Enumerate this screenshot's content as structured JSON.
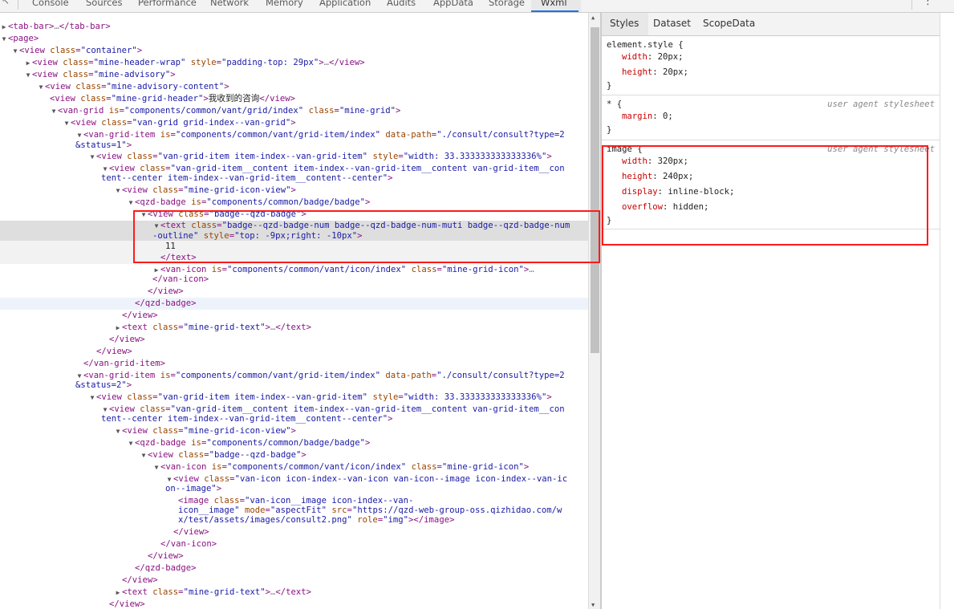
{
  "devtools_tabs": [
    "Console",
    "Sources",
    "Performance",
    "Network",
    "Memory",
    "Application",
    "Audits",
    "AppData",
    "Storage",
    "Wxml"
  ],
  "active_tab": "Wxml",
  "elements": {
    "l01": {
      "a": "<tab-bar>",
      "b": "…",
      "c": "</tab-bar>"
    },
    "l02": {
      "t": "<page>"
    },
    "l03": {
      "open": "<view",
      "an": "class",
      "av": "\"container\"",
      "close": ">"
    },
    "l04": {
      "open": "<view",
      "an": "class",
      "av": "\"mine-header-wrap\"",
      "an2": "style",
      "av2": "\"padding-top: 29px\"",
      "close": ">",
      "ell": "…",
      "end": "</view>"
    },
    "l05": {
      "open": "<view",
      "an": "class",
      "av": "\"mine-advisory\"",
      "close": ">"
    },
    "l06": {
      "open": "<view",
      "an": "class",
      "av": "\"mine-advisory-content\"",
      "close": ">"
    },
    "l07": {
      "open": "<view",
      "an": "class",
      "av": "\"mine-grid-header\"",
      "close": ">",
      "text": "我收到的咨询",
      "end": "</view>"
    },
    "l08": {
      "open": "<van-grid",
      "an": "is",
      "av": "\"components/common/vant/grid/index\"",
      "an2": "class",
      "av2": "\"mine-grid\"",
      "close": ">"
    },
    "l09": {
      "open": "<view",
      "an": "class",
      "av": "\"van-grid grid-index--van-grid\"",
      "close": ">"
    },
    "l10": {
      "open": "<van-grid-item",
      "an": "is",
      "av": "\"components/common/vant/grid-item/index\"",
      "an2": "data-path",
      "av2": "\"./consult/consult?type=2"
    },
    "l10b": {
      "av": "&status=1\"",
      "close": ">"
    },
    "l11": {
      "open": "<view",
      "an": "class",
      "av": "\"van-grid-item item-index--van-grid-item\"",
      "an2": "style",
      "av2": "\"width: 33.333333333333336%\"",
      "close": ">"
    },
    "l12": {
      "open": "<view",
      "an": "class",
      "av": "\"van-grid-item__content item-index--van-grid-item__content van-grid-item__con"
    },
    "l12b": {
      "av": "tent--center item-index--van-grid-item__content--center\"",
      "close": ">"
    },
    "l13": {
      "open": "<view",
      "an": "class",
      "av": "\"mine-grid-icon-view\"",
      "close": ">"
    },
    "l14": {
      "open": "<qzd-badge",
      "an": "is",
      "av": "\"components/common/badge/badge\"",
      "close": ">"
    },
    "l15": {
      "open": "<view",
      "an": "class",
      "av": "\"badge--qzd-badge\"",
      "close": ">"
    },
    "l16": {
      "open": "<text",
      "an": "class",
      "av": "\"badge--qzd-badge-num badge--qzd-badge-num-muti badge--qzd-badge-num"
    },
    "l16b": {
      "av": "-outline\"",
      "an2": "style",
      "av2": "\"top: -9px;right: -10px\"",
      "close": ">"
    },
    "l17": {
      "t": "11"
    },
    "l18": {
      "t": "</text>"
    },
    "l19": {
      "open": "<van-icon",
      "an": "is",
      "av": "\"components/common/vant/icon/index\"",
      "an2": "class",
      "av2": "\"mine-grid-icon\"",
      "close": ">",
      "ell": "…"
    },
    "l20": {
      "t": "</van-icon>"
    },
    "l21": {
      "t": "</view>"
    },
    "l22": {
      "t": "</qzd-badge>"
    },
    "l23": {
      "t": "</view>"
    },
    "l24": {
      "open": "<text",
      "an": "class",
      "av": "\"mine-grid-text\"",
      "close": ">",
      "ell": "…",
      "end": "</text>"
    },
    "l25": {
      "t": "</view>"
    },
    "l26": {
      "t": "</view>"
    },
    "l27": {
      "t": "</van-grid-item>"
    },
    "l28": {
      "open": "<van-grid-item",
      "an": "is",
      "av": "\"components/common/vant/grid-item/index\"",
      "an2": "data-path",
      "av2": "\"./consult/consult?type=2"
    },
    "l28b": {
      "av": "&status=2\"",
      "close": ">"
    },
    "l29": {
      "open": "<view",
      "an": "class",
      "av": "\"van-grid-item item-index--van-grid-item\"",
      "an2": "style",
      "av2": "\"width: 33.333333333333336%\"",
      "close": ">"
    },
    "l30": {
      "open": "<view",
      "an": "class",
      "av": "\"van-grid-item__content item-index--van-grid-item__content van-grid-item__con"
    },
    "l30b": {
      "av": "tent--center item-index--van-grid-item__content--center\"",
      "close": ">"
    },
    "l31": {
      "open": "<view",
      "an": "class",
      "av": "\"mine-grid-icon-view\"",
      "close": ">"
    },
    "l32": {
      "open": "<qzd-badge",
      "an": "is",
      "av": "\"components/common/badge/badge\"",
      "close": ">"
    },
    "l33": {
      "open": "<view",
      "an": "class",
      "av": "\"badge--qzd-badge\"",
      "close": ">"
    },
    "l34": {
      "open": "<van-icon",
      "an": "is",
      "av": "\"components/common/vant/icon/index\"",
      "an2": "class",
      "av2": "\"mine-grid-icon\"",
      "close": ">"
    },
    "l35": {
      "open": "<view",
      "an": "class",
      "av": "\"van-icon icon-index--van-icon van-icon--image icon-index--van-ic"
    },
    "l35b": {
      "av": "on--image\"",
      "close": ">"
    },
    "l36": {
      "open": "<image",
      "an": "class",
      "av": "\"van-icon__image icon-index--van-"
    },
    "l36b": {
      "av": "icon__image\"",
      "an2": "mode",
      "av2": "\"aspectFit\"",
      "an3": "src",
      "av3": "\"https://qzd-web-group-oss.qizhidao.com/w"
    },
    "l36c": {
      "av": "x/test/assets/images/consult2.png\"",
      "an2": "role",
      "av2": "\"img\"",
      "close": "></image>"
    },
    "l37": {
      "t": "</view>"
    },
    "l38": {
      "t": "</van-icon>"
    },
    "l39": {
      "t": "</view>"
    },
    "l40": {
      "t": "</qzd-badge>"
    },
    "l41": {
      "t": "</view>"
    },
    "l42": {
      "open": "<text",
      "an": "class",
      "av": "\"mine-grid-text\"",
      "close": ">",
      "ell": "…",
      "end": "</text>"
    },
    "l43": {
      "t": "</view>"
    }
  },
  "styles_panel": {
    "tabs": [
      "Styles",
      "Dataset",
      "ScopeData"
    ],
    "rule1": {
      "selector": "element.style {",
      "p1n": "width",
      "p1v": ": 20px;",
      "p2n": "height",
      "p2v": ": 20px;",
      "close": "}"
    },
    "rule2": {
      "selector": "* {",
      "origin": "user agent stylesheet",
      "p1n": "margin",
      "p1v": ": 0;",
      "close": "}"
    },
    "rule3": {
      "selector": "image {",
      "origin": "user agent stylesheet",
      "p1n": "width",
      "p1v": ": 320px;",
      "p2n": "height",
      "p2v": ": 240px;",
      "p3n": "display",
      "p3v": ": inline-block;",
      "p4n": "overflow",
      "p4v": ": hidden;",
      "close": "}"
    }
  }
}
